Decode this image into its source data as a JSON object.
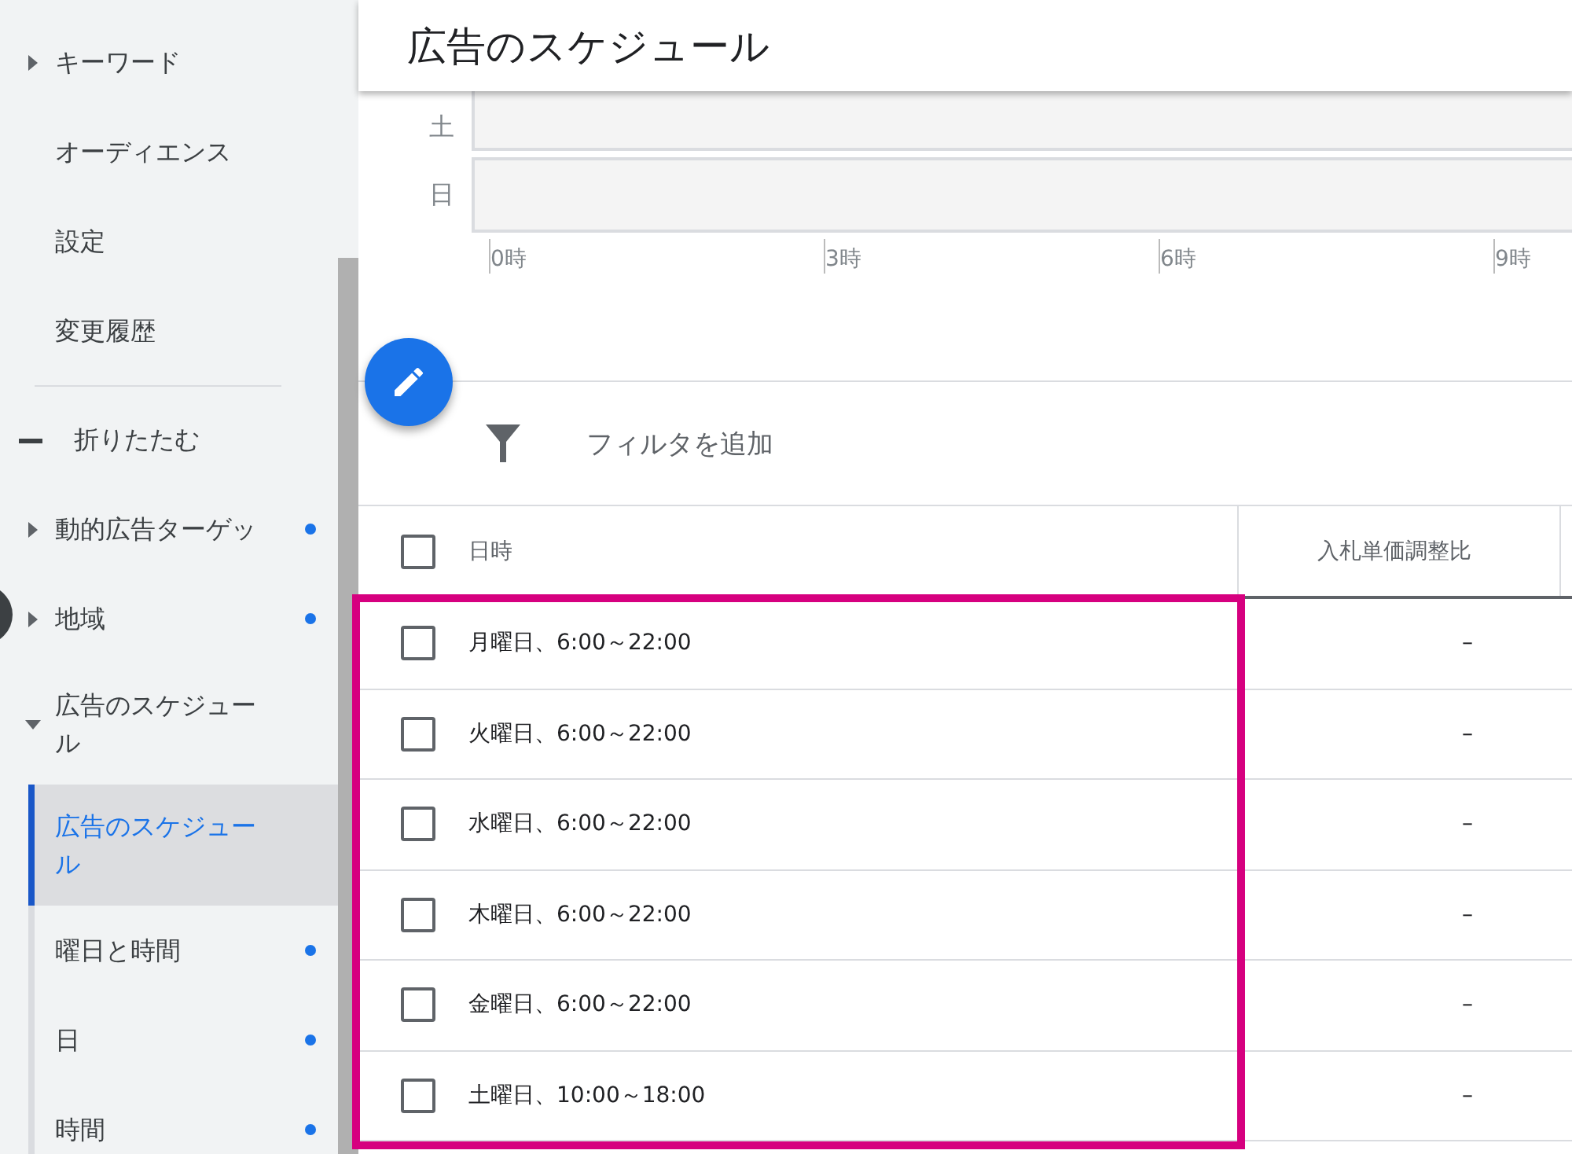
{
  "sidebar": {
    "items": [
      {
        "kind": "group",
        "label": "キーワード",
        "expanded": false,
        "dot": false
      },
      {
        "kind": "link",
        "label": "オーディエンス",
        "dot": false
      },
      {
        "kind": "link",
        "label": "設定",
        "dot": false
      },
      {
        "kind": "link",
        "label": "変更履歴",
        "dot": false
      },
      {
        "kind": "divider"
      },
      {
        "kind": "collapse",
        "label": "折りたたむ"
      },
      {
        "kind": "group",
        "label": "動的広告ターゲッ",
        "expanded": false,
        "dot": true
      },
      {
        "kind": "group",
        "label": "地域",
        "expanded": false,
        "dot": true
      },
      {
        "kind": "group",
        "label": "広告のスケジュール",
        "expanded": true,
        "dot": false,
        "children": [
          {
            "label": "広告のスケジュール",
            "selected": true,
            "dot": false
          },
          {
            "label": "曜日と時間",
            "selected": false,
            "dot": true
          },
          {
            "label": "日",
            "selected": false,
            "dot": true
          },
          {
            "label": "時間",
            "selected": false,
            "dot": true
          }
        ]
      }
    ]
  },
  "header": {
    "title": "広告のスケジュール"
  },
  "schedule_chart": {
    "rows": [
      "土",
      "日"
    ],
    "ticks": [
      "0時",
      "3時",
      "6時",
      "9時"
    ]
  },
  "filter": {
    "label": "フィルタを追加"
  },
  "table": {
    "columns": [
      "日時",
      "入札単価調整比"
    ],
    "select_all_checked": false,
    "highlighted": true,
    "rows": [
      {
        "checked": false,
        "cells": [
          "月曜日、6:00～22:00",
          "–"
        ]
      },
      {
        "checked": false,
        "cells": [
          "火曜日、6:00～22:00",
          "–"
        ]
      },
      {
        "checked": false,
        "cells": [
          "水曜日、6:00～22:00",
          "–"
        ]
      },
      {
        "checked": false,
        "cells": [
          "木曜日、6:00～22:00",
          "–"
        ]
      },
      {
        "checked": false,
        "cells": [
          "金曜日、6:00～22:00",
          "–"
        ]
      },
      {
        "checked": false,
        "cells": [
          "土曜日、10:00～18:00",
          "–"
        ]
      }
    ]
  }
}
